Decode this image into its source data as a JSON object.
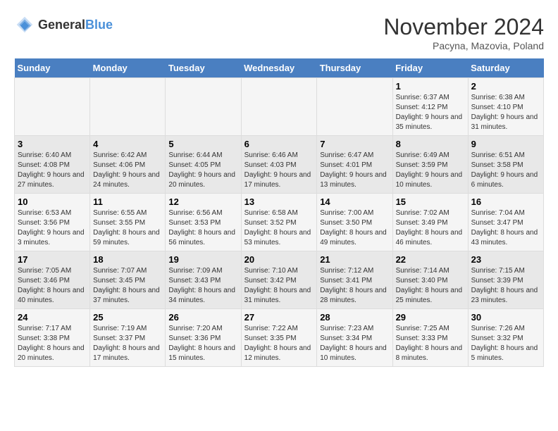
{
  "header": {
    "logo_general": "General",
    "logo_blue": "Blue",
    "month_title": "November 2024",
    "location": "Pacyna, Mazovia, Poland"
  },
  "days_of_week": [
    "Sunday",
    "Monday",
    "Tuesday",
    "Wednesday",
    "Thursday",
    "Friday",
    "Saturday"
  ],
  "weeks": [
    [
      {
        "day": "",
        "info": ""
      },
      {
        "day": "",
        "info": ""
      },
      {
        "day": "",
        "info": ""
      },
      {
        "day": "",
        "info": ""
      },
      {
        "day": "",
        "info": ""
      },
      {
        "day": "1",
        "info": "Sunrise: 6:37 AM\nSunset: 4:12 PM\nDaylight: 9 hours and 35 minutes."
      },
      {
        "day": "2",
        "info": "Sunrise: 6:38 AM\nSunset: 4:10 PM\nDaylight: 9 hours and 31 minutes."
      }
    ],
    [
      {
        "day": "3",
        "info": "Sunrise: 6:40 AM\nSunset: 4:08 PM\nDaylight: 9 hours and 27 minutes."
      },
      {
        "day": "4",
        "info": "Sunrise: 6:42 AM\nSunset: 4:06 PM\nDaylight: 9 hours and 24 minutes."
      },
      {
        "day": "5",
        "info": "Sunrise: 6:44 AM\nSunset: 4:05 PM\nDaylight: 9 hours and 20 minutes."
      },
      {
        "day": "6",
        "info": "Sunrise: 6:46 AM\nSunset: 4:03 PM\nDaylight: 9 hours and 17 minutes."
      },
      {
        "day": "7",
        "info": "Sunrise: 6:47 AM\nSunset: 4:01 PM\nDaylight: 9 hours and 13 minutes."
      },
      {
        "day": "8",
        "info": "Sunrise: 6:49 AM\nSunset: 3:59 PM\nDaylight: 9 hours and 10 minutes."
      },
      {
        "day": "9",
        "info": "Sunrise: 6:51 AM\nSunset: 3:58 PM\nDaylight: 9 hours and 6 minutes."
      }
    ],
    [
      {
        "day": "10",
        "info": "Sunrise: 6:53 AM\nSunset: 3:56 PM\nDaylight: 9 hours and 3 minutes."
      },
      {
        "day": "11",
        "info": "Sunrise: 6:55 AM\nSunset: 3:55 PM\nDaylight: 8 hours and 59 minutes."
      },
      {
        "day": "12",
        "info": "Sunrise: 6:56 AM\nSunset: 3:53 PM\nDaylight: 8 hours and 56 minutes."
      },
      {
        "day": "13",
        "info": "Sunrise: 6:58 AM\nSunset: 3:52 PM\nDaylight: 8 hours and 53 minutes."
      },
      {
        "day": "14",
        "info": "Sunrise: 7:00 AM\nSunset: 3:50 PM\nDaylight: 8 hours and 49 minutes."
      },
      {
        "day": "15",
        "info": "Sunrise: 7:02 AM\nSunset: 3:49 PM\nDaylight: 8 hours and 46 minutes."
      },
      {
        "day": "16",
        "info": "Sunrise: 7:04 AM\nSunset: 3:47 PM\nDaylight: 8 hours and 43 minutes."
      }
    ],
    [
      {
        "day": "17",
        "info": "Sunrise: 7:05 AM\nSunset: 3:46 PM\nDaylight: 8 hours and 40 minutes."
      },
      {
        "day": "18",
        "info": "Sunrise: 7:07 AM\nSunset: 3:45 PM\nDaylight: 8 hours and 37 minutes."
      },
      {
        "day": "19",
        "info": "Sunrise: 7:09 AM\nSunset: 3:43 PM\nDaylight: 8 hours and 34 minutes."
      },
      {
        "day": "20",
        "info": "Sunrise: 7:10 AM\nSunset: 3:42 PM\nDaylight: 8 hours and 31 minutes."
      },
      {
        "day": "21",
        "info": "Sunrise: 7:12 AM\nSunset: 3:41 PM\nDaylight: 8 hours and 28 minutes."
      },
      {
        "day": "22",
        "info": "Sunrise: 7:14 AM\nSunset: 3:40 PM\nDaylight: 8 hours and 25 minutes."
      },
      {
        "day": "23",
        "info": "Sunrise: 7:15 AM\nSunset: 3:39 PM\nDaylight: 8 hours and 23 minutes."
      }
    ],
    [
      {
        "day": "24",
        "info": "Sunrise: 7:17 AM\nSunset: 3:38 PM\nDaylight: 8 hours and 20 minutes."
      },
      {
        "day": "25",
        "info": "Sunrise: 7:19 AM\nSunset: 3:37 PM\nDaylight: 8 hours and 17 minutes."
      },
      {
        "day": "26",
        "info": "Sunrise: 7:20 AM\nSunset: 3:36 PM\nDaylight: 8 hours and 15 minutes."
      },
      {
        "day": "27",
        "info": "Sunrise: 7:22 AM\nSunset: 3:35 PM\nDaylight: 8 hours and 12 minutes."
      },
      {
        "day": "28",
        "info": "Sunrise: 7:23 AM\nSunset: 3:34 PM\nDaylight: 8 hours and 10 minutes."
      },
      {
        "day": "29",
        "info": "Sunrise: 7:25 AM\nSunset: 3:33 PM\nDaylight: 8 hours and 8 minutes."
      },
      {
        "day": "30",
        "info": "Sunrise: 7:26 AM\nSunset: 3:32 PM\nDaylight: 8 hours and 5 minutes."
      }
    ]
  ]
}
